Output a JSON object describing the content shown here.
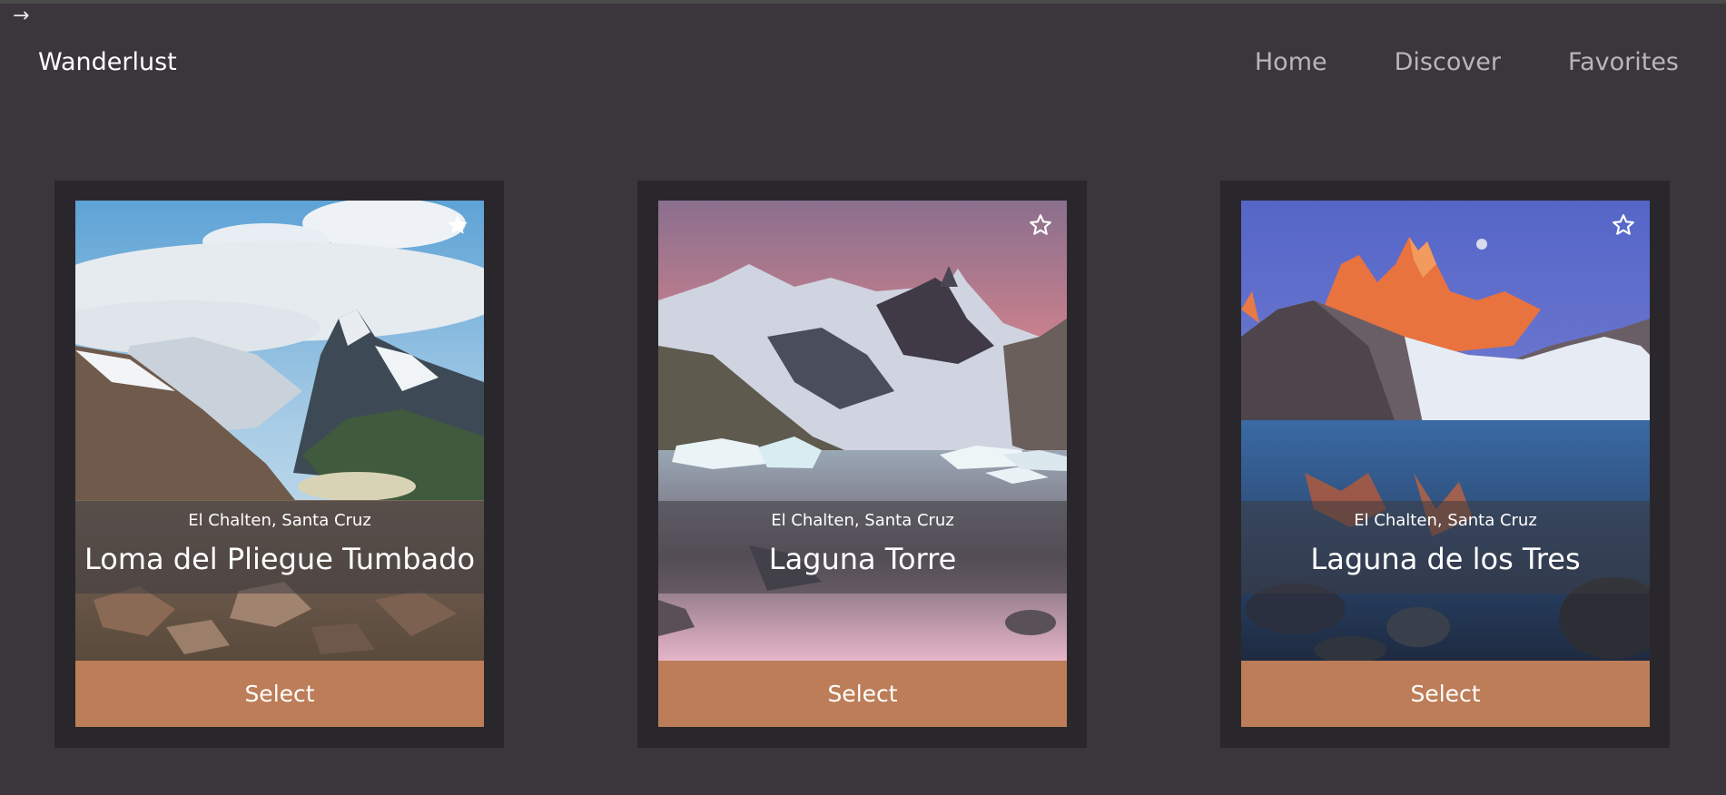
{
  "top_icon": "arrow-right-icon",
  "header": {
    "brand": "Wanderlust",
    "nav": [
      {
        "label": "Home"
      },
      {
        "label": "Discover"
      },
      {
        "label": "Favorites"
      }
    ]
  },
  "cards": [
    {
      "location": "El Chalten, Santa Cruz",
      "title": "Loma del Pliegue Tumbado",
      "favorite": true,
      "favorite_icon": "star-filled-icon",
      "button_label": "Select"
    },
    {
      "location": "El Chalten, Santa Cruz",
      "title": "Laguna Torre",
      "favorite": false,
      "favorite_icon": "star-outline-icon",
      "button_label": "Select"
    },
    {
      "location": "El Chalten, Santa Cruz",
      "title": "Laguna de los Tres",
      "favorite": false,
      "favorite_icon": "star-outline-icon",
      "button_label": "Select"
    }
  ],
  "colors": {
    "background": "#3a363c",
    "card_frame": "#2a272c",
    "accent_button": "#bd7d58",
    "nav_text": "#b9b6bb"
  }
}
